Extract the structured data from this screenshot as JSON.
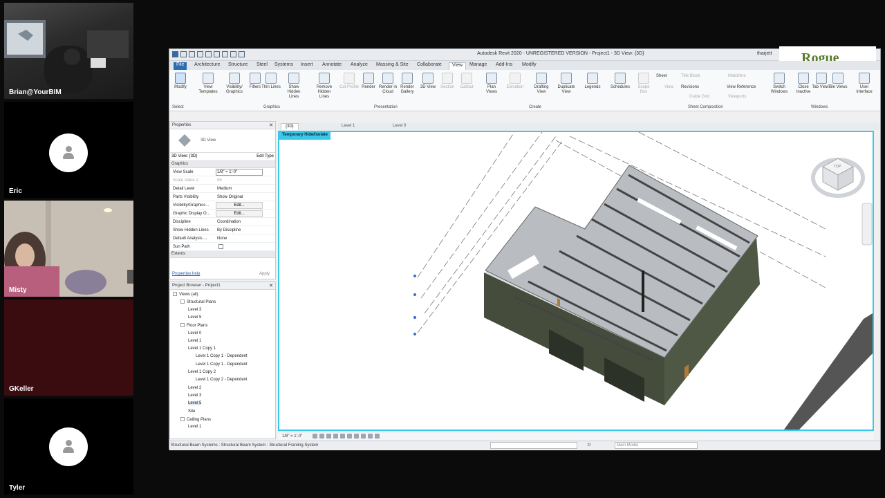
{
  "participants": [
    {
      "name": "Brian@YourBIM",
      "video": true
    },
    {
      "name": "Eric",
      "video": false
    },
    {
      "name": "Misty",
      "video": true
    },
    {
      "name": "GKeller",
      "video": false
    },
    {
      "name": "Tyler",
      "video": false
    }
  ],
  "app": {
    "title": "Autodesk Revit 2020 - UNREGISTERED VERSION - Project1 - 3D View: {3D}",
    "user": "tharjett",
    "logo_text": "Rogue"
  },
  "menu": [
    "File",
    "Architecture",
    "Structure",
    "Steel",
    "Systems",
    "Insert",
    "Annotate",
    "Analyze",
    "Massing & Site",
    "Collaborate",
    "View",
    "Manage",
    "Add-Ins",
    "Modify"
  ],
  "menu_active": "View",
  "ribbon": {
    "buttons": [
      {
        "label": "Modify"
      },
      {
        "label": "View Templates"
      },
      {
        "label": "Visibility/ Graphics"
      },
      {
        "label": "Filters"
      },
      {
        "label": "Thin Lines"
      },
      {
        "label": "Show Hidden Lines"
      },
      {
        "label": "Remove Hidden Lines"
      },
      {
        "label": "Cut Profile"
      },
      {
        "label": "Render"
      },
      {
        "label": "Render in Cloud"
      },
      {
        "label": "Render Gallery"
      },
      {
        "label": "3D View"
      },
      {
        "label": "Section"
      },
      {
        "label": "Callout"
      },
      {
        "label": "Plan Views"
      },
      {
        "label": "Elevation"
      },
      {
        "label": "Drafting View"
      },
      {
        "label": "Duplicate View"
      },
      {
        "label": "Legends"
      },
      {
        "label": "Schedules"
      },
      {
        "label": "Scope Box"
      },
      {
        "label": "Switch Windows"
      },
      {
        "label": "Close Inactive"
      },
      {
        "label": "Tab Views"
      },
      {
        "label": "Tile Views"
      },
      {
        "label": "User Interface"
      }
    ],
    "small": [
      "Sheet",
      "Title Block",
      "Matchline",
      "View",
      "Revisions",
      "View Reference",
      "Guide Grid",
      "Viewports"
    ],
    "groups": [
      "Select",
      "Graphics",
      "Presentation",
      "Create",
      "Sheet Composition",
      "Windows"
    ]
  },
  "properties": {
    "header": "Properties",
    "type": "3D View",
    "selector": "3D View: {3D}",
    "edit_type": "Edit Type",
    "section_graphics": "Graphics",
    "rows": [
      {
        "k": "View Scale",
        "v": "1/8\" = 1'-0\""
      },
      {
        "k": "Scale Value    1:",
        "v": "96"
      },
      {
        "k": "Detail Level",
        "v": "Medium"
      },
      {
        "k": "Parts Visibility",
        "v": "Show Original"
      },
      {
        "k": "Visibility/Graphics...",
        "v": "Edit..."
      },
      {
        "k": "Graphic Display O...",
        "v": "Edit..."
      },
      {
        "k": "Discipline",
        "v": "Coordination"
      },
      {
        "k": "Show Hidden Lines",
        "v": "By Discipline"
      },
      {
        "k": "Default Analysis ...",
        "v": "None"
      },
      {
        "k": "Sun Path",
        "v": ""
      }
    ],
    "section_extents": "Extents",
    "help": "Properties help",
    "apply": "Apply"
  },
  "browser": {
    "header": "Project Browser - Project1",
    "items": [
      {
        "label": "Views (all)",
        "indent": 0
      },
      {
        "label": "Structural Plans",
        "indent": 1
      },
      {
        "label": "Level 3",
        "indent": 2
      },
      {
        "label": "Level 5",
        "indent": 2
      },
      {
        "label": "Floor Plans",
        "indent": 1
      },
      {
        "label": "Level 0",
        "indent": 2
      },
      {
        "label": "Level 1",
        "indent": 2
      },
      {
        "label": "Level 1 Copy 1",
        "indent": 2
      },
      {
        "label": "Level 1 Copy 1 - Dependent",
        "indent": 3
      },
      {
        "label": "Level 1 Copy 1 - Dependent",
        "indent": 3
      },
      {
        "label": "Level 1 Copy 2",
        "indent": 2
      },
      {
        "label": "Level 1 Copy 2 - Dependent",
        "indent": 3
      },
      {
        "label": "Level 2",
        "indent": 2
      },
      {
        "label": "Level 3",
        "indent": 2
      },
      {
        "label": "Level 5",
        "indent": 2
      },
      {
        "label": "Site",
        "indent": 2
      },
      {
        "label": "Ceiling Plans",
        "indent": 1
      },
      {
        "label": "Level 1",
        "indent": 2
      }
    ],
    "selected": 14
  },
  "view_tabs": [
    "{3D}",
    "Level 1",
    "Level 0"
  ],
  "viewport": {
    "temp_isolate": "Temporary Hide/Isolate",
    "viewcube_label": "TOP"
  },
  "viewbar": {
    "scale": "1/8\" = 1'-0\""
  },
  "status": {
    "message": "Structural Beam Systems : Structural Beam System : Structural Framing System",
    "coord": ":0",
    "model": "Main Model"
  },
  "colors": {
    "viewport_border": "#39c8e8",
    "file_tab": "#2f6cb0",
    "wall": "#4a5240"
  }
}
